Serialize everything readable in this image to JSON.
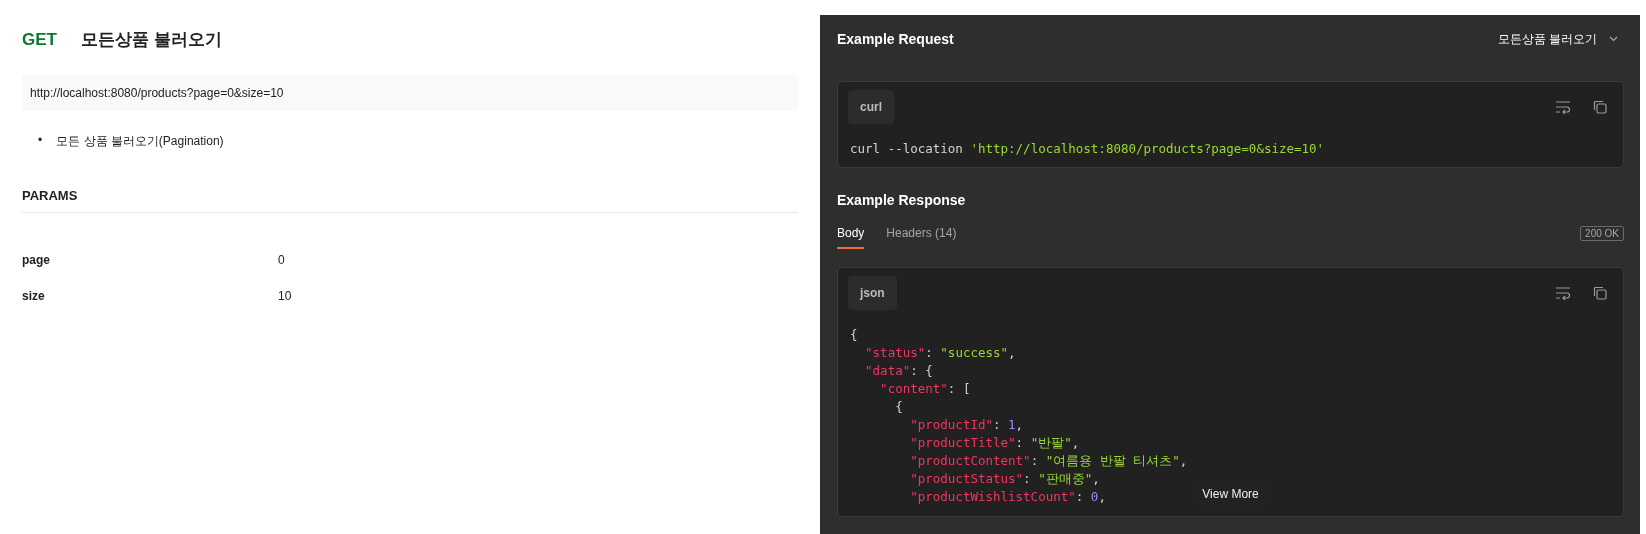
{
  "request": {
    "method": "GET",
    "title": "모든상품 불러오기",
    "url": "http://localhost:8080/products?page=0&size=10",
    "description": [
      {
        "marker": "•",
        "text": "모든 상품 불러오기(Pagination)"
      }
    ]
  },
  "params": {
    "heading": "PARAMS",
    "rows": [
      {
        "key": "page",
        "value": "0"
      },
      {
        "key": "size",
        "value": "10"
      }
    ]
  },
  "example_request": {
    "title": "Example Request",
    "selector": "모든상품 불러오기",
    "language": "curl",
    "code": [
      {
        "kind": "plain",
        "text": "curl --location "
      },
      {
        "kind": "string",
        "text": "'http://localhost:8080/products?page=0&size=10'"
      }
    ]
  },
  "example_response": {
    "title": "Example Response",
    "tabs": [
      {
        "label": "Body",
        "selected": true
      },
      {
        "label": "Headers (14)",
        "selected": false
      }
    ],
    "status": "200 OK",
    "language": "json",
    "view_more": "View More",
    "lines": [
      [
        {
          "kind": "punct",
          "text": "{"
        }
      ],
      [
        {
          "kind": "key",
          "text": "  \"status\""
        },
        {
          "kind": "punct",
          "text": ": "
        },
        {
          "kind": "string",
          "text": "\"success\""
        },
        {
          "kind": "punct",
          "text": ","
        }
      ],
      [
        {
          "kind": "key",
          "text": "  \"data\""
        },
        {
          "kind": "punct",
          "text": ": {"
        }
      ],
      [
        {
          "kind": "key",
          "text": "    \"content\""
        },
        {
          "kind": "punct",
          "text": ": ["
        }
      ],
      [
        {
          "kind": "punct",
          "text": "      {"
        }
      ],
      [
        {
          "kind": "key",
          "text": "        \"productId\""
        },
        {
          "kind": "punct",
          "text": ": "
        },
        {
          "kind": "number",
          "text": "1"
        },
        {
          "kind": "punct",
          "text": ","
        }
      ],
      [
        {
          "kind": "key",
          "text": "        \"productTitle\""
        },
        {
          "kind": "punct",
          "text": ": "
        },
        {
          "kind": "string",
          "text": "\"반팔\""
        },
        {
          "kind": "punct",
          "text": ","
        }
      ],
      [
        {
          "kind": "key",
          "text": "        \"productContent\""
        },
        {
          "kind": "punct",
          "text": ": "
        },
        {
          "kind": "string",
          "text": "\"여름용 반팔 티셔츠\""
        },
        {
          "kind": "punct",
          "text": ","
        }
      ],
      [
        {
          "kind": "key",
          "text": "        \"productStatus\""
        },
        {
          "kind": "punct",
          "text": ": "
        },
        {
          "kind": "string",
          "text": "\"판매중\""
        },
        {
          "kind": "punct",
          "text": ","
        }
      ],
      [
        {
          "kind": "key",
          "text": "        \"productWishlistCount\""
        },
        {
          "kind": "punct",
          "text": ": "
        },
        {
          "kind": "number",
          "text": "0"
        },
        {
          "kind": "punct",
          "text": ","
        }
      ]
    ]
  }
}
